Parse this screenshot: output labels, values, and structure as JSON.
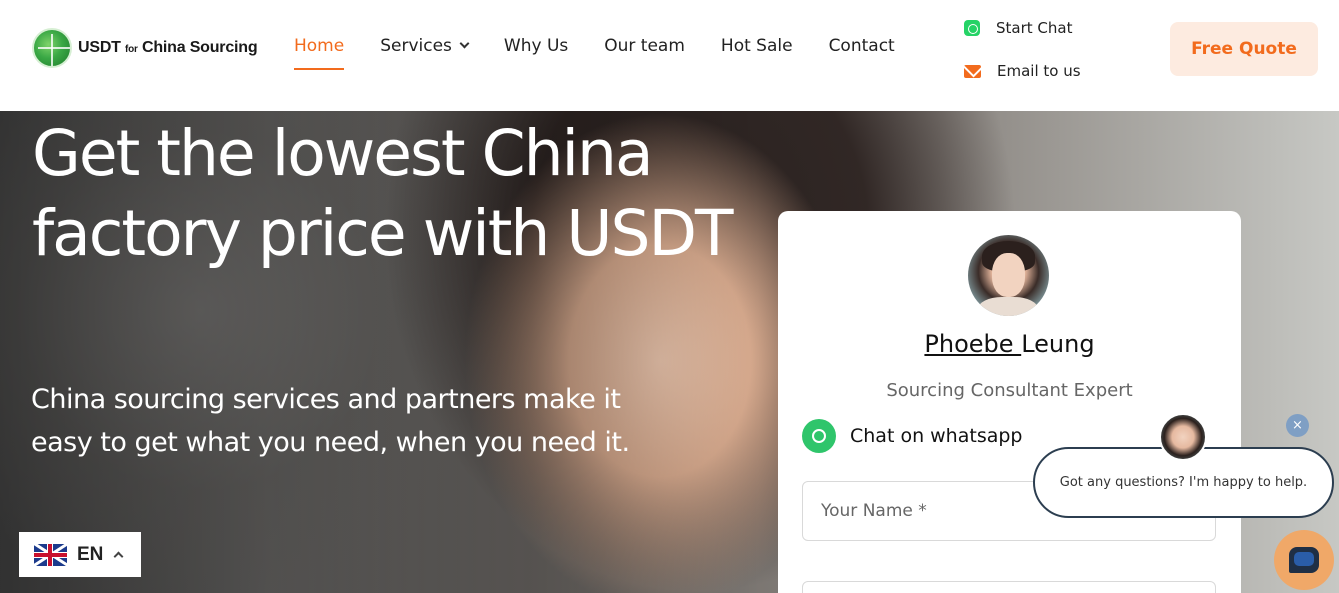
{
  "brand": {
    "name_prefix": "USDT",
    "name_small": "for",
    "name_suffix": "China Sourcing"
  },
  "nav": {
    "items": [
      {
        "label": "Home",
        "active": true
      },
      {
        "label": "Services",
        "active": false
      },
      {
        "label": "Why Us",
        "active": false
      },
      {
        "label": "Our team",
        "active": false
      },
      {
        "label": "Hot Sale",
        "active": false
      },
      {
        "label": "Contact",
        "active": false
      }
    ]
  },
  "header_contact": {
    "chat_label": "Start Chat",
    "email_label": "Email to us"
  },
  "cta": {
    "quote_label": "Free Quote"
  },
  "hero": {
    "title": "Get the lowest China factory price with USDT",
    "subtitle": "China sourcing services and partners make it easy to get what you need, when you need it."
  },
  "form": {
    "agent_first": "Phoebe ",
    "agent_last": "Leung",
    "agent_title": "Sourcing Consultant Expert",
    "whatsapp_label": "Chat on whatsapp",
    "name_placeholder": "Your Name *"
  },
  "chat_widget": {
    "message": "Got any questions? I'm happy to help.",
    "close_glyph": "×"
  },
  "language": {
    "code": "EN"
  },
  "colors": {
    "accent": "#f26b1d",
    "accent_soft": "#fdebe0",
    "whatsapp": "#25d366",
    "chat_launcher": "#f0a868"
  },
  "icons": {
    "logo": "globe-icon",
    "chat": "whatsapp-icon",
    "email": "envelope-icon",
    "services_dropdown": "chevron-down-icon",
    "language_toggle": "chevron-up-icon",
    "launcher": "chat-bubble-icon"
  }
}
